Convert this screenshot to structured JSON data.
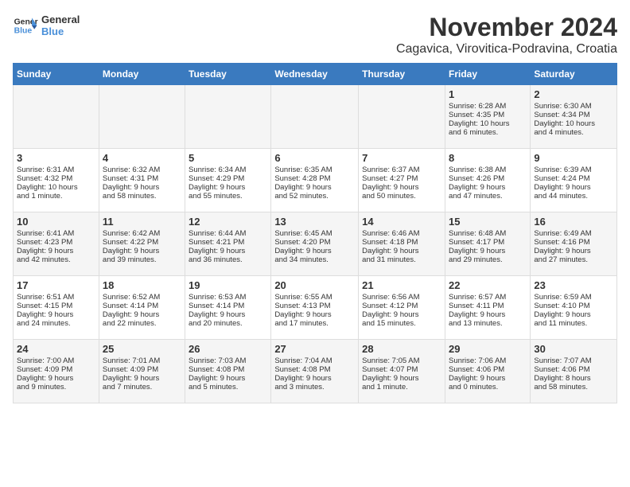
{
  "header": {
    "logo_line1": "General",
    "logo_line2": "Blue",
    "month": "November 2024",
    "location": "Cagavica, Virovitica-Podravina, Croatia"
  },
  "columns": [
    "Sunday",
    "Monday",
    "Tuesday",
    "Wednesday",
    "Thursday",
    "Friday",
    "Saturday"
  ],
  "weeks": [
    [
      {
        "day": "",
        "text": ""
      },
      {
        "day": "",
        "text": ""
      },
      {
        "day": "",
        "text": ""
      },
      {
        "day": "",
        "text": ""
      },
      {
        "day": "",
        "text": ""
      },
      {
        "day": "1",
        "text": "Sunrise: 6:28 AM\nSunset: 4:35 PM\nDaylight: 10 hours\nand 6 minutes."
      },
      {
        "day": "2",
        "text": "Sunrise: 6:30 AM\nSunset: 4:34 PM\nDaylight: 10 hours\nand 4 minutes."
      }
    ],
    [
      {
        "day": "3",
        "text": "Sunrise: 6:31 AM\nSunset: 4:32 PM\nDaylight: 10 hours\nand 1 minute."
      },
      {
        "day": "4",
        "text": "Sunrise: 6:32 AM\nSunset: 4:31 PM\nDaylight: 9 hours\nand 58 minutes."
      },
      {
        "day": "5",
        "text": "Sunrise: 6:34 AM\nSunset: 4:29 PM\nDaylight: 9 hours\nand 55 minutes."
      },
      {
        "day": "6",
        "text": "Sunrise: 6:35 AM\nSunset: 4:28 PM\nDaylight: 9 hours\nand 52 minutes."
      },
      {
        "day": "7",
        "text": "Sunrise: 6:37 AM\nSunset: 4:27 PM\nDaylight: 9 hours\nand 50 minutes."
      },
      {
        "day": "8",
        "text": "Sunrise: 6:38 AM\nSunset: 4:26 PM\nDaylight: 9 hours\nand 47 minutes."
      },
      {
        "day": "9",
        "text": "Sunrise: 6:39 AM\nSunset: 4:24 PM\nDaylight: 9 hours\nand 44 minutes."
      }
    ],
    [
      {
        "day": "10",
        "text": "Sunrise: 6:41 AM\nSunset: 4:23 PM\nDaylight: 9 hours\nand 42 minutes."
      },
      {
        "day": "11",
        "text": "Sunrise: 6:42 AM\nSunset: 4:22 PM\nDaylight: 9 hours\nand 39 minutes."
      },
      {
        "day": "12",
        "text": "Sunrise: 6:44 AM\nSunset: 4:21 PM\nDaylight: 9 hours\nand 36 minutes."
      },
      {
        "day": "13",
        "text": "Sunrise: 6:45 AM\nSunset: 4:20 PM\nDaylight: 9 hours\nand 34 minutes."
      },
      {
        "day": "14",
        "text": "Sunrise: 6:46 AM\nSunset: 4:18 PM\nDaylight: 9 hours\nand 31 minutes."
      },
      {
        "day": "15",
        "text": "Sunrise: 6:48 AM\nSunset: 4:17 PM\nDaylight: 9 hours\nand 29 minutes."
      },
      {
        "day": "16",
        "text": "Sunrise: 6:49 AM\nSunset: 4:16 PM\nDaylight: 9 hours\nand 27 minutes."
      }
    ],
    [
      {
        "day": "17",
        "text": "Sunrise: 6:51 AM\nSunset: 4:15 PM\nDaylight: 9 hours\nand 24 minutes."
      },
      {
        "day": "18",
        "text": "Sunrise: 6:52 AM\nSunset: 4:14 PM\nDaylight: 9 hours\nand 22 minutes."
      },
      {
        "day": "19",
        "text": "Sunrise: 6:53 AM\nSunset: 4:14 PM\nDaylight: 9 hours\nand 20 minutes."
      },
      {
        "day": "20",
        "text": "Sunrise: 6:55 AM\nSunset: 4:13 PM\nDaylight: 9 hours\nand 17 minutes."
      },
      {
        "day": "21",
        "text": "Sunrise: 6:56 AM\nSunset: 4:12 PM\nDaylight: 9 hours\nand 15 minutes."
      },
      {
        "day": "22",
        "text": "Sunrise: 6:57 AM\nSunset: 4:11 PM\nDaylight: 9 hours\nand 13 minutes."
      },
      {
        "day": "23",
        "text": "Sunrise: 6:59 AM\nSunset: 4:10 PM\nDaylight: 9 hours\nand 11 minutes."
      }
    ],
    [
      {
        "day": "24",
        "text": "Sunrise: 7:00 AM\nSunset: 4:09 PM\nDaylight: 9 hours\nand 9 minutes."
      },
      {
        "day": "25",
        "text": "Sunrise: 7:01 AM\nSunset: 4:09 PM\nDaylight: 9 hours\nand 7 minutes."
      },
      {
        "day": "26",
        "text": "Sunrise: 7:03 AM\nSunset: 4:08 PM\nDaylight: 9 hours\nand 5 minutes."
      },
      {
        "day": "27",
        "text": "Sunrise: 7:04 AM\nSunset: 4:08 PM\nDaylight: 9 hours\nand 3 minutes."
      },
      {
        "day": "28",
        "text": "Sunrise: 7:05 AM\nSunset: 4:07 PM\nDaylight: 9 hours\nand 1 minute."
      },
      {
        "day": "29",
        "text": "Sunrise: 7:06 AM\nSunset: 4:06 PM\nDaylight: 9 hours\nand 0 minutes."
      },
      {
        "day": "30",
        "text": "Sunrise: 7:07 AM\nSunset: 4:06 PM\nDaylight: 8 hours\nand 58 minutes."
      }
    ]
  ]
}
